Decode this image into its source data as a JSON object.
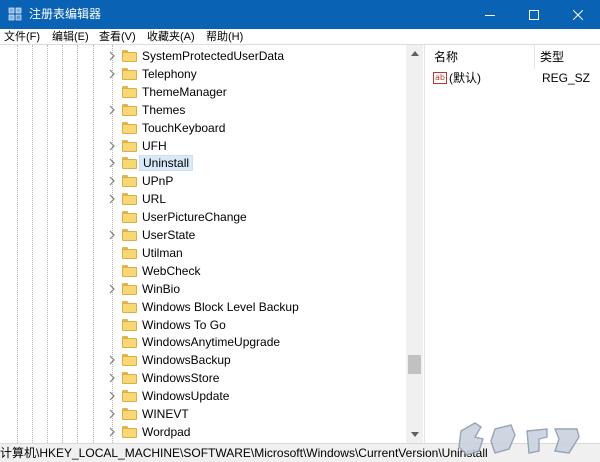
{
  "window": {
    "title": "注册表编辑器",
    "title_bar_color": "#0a62b5"
  },
  "menu": {
    "items": [
      "文件(F)",
      "编辑(E)",
      "查看(V)",
      "收藏夹(A)",
      "帮助(H)"
    ]
  },
  "tree": {
    "items": [
      {
        "label": "SystemProtectedUserData",
        "expandable": true,
        "selected": false
      },
      {
        "label": "Telephony",
        "expandable": true,
        "selected": false
      },
      {
        "label": "ThemeManager",
        "expandable": false,
        "selected": false
      },
      {
        "label": "Themes",
        "expandable": true,
        "selected": false
      },
      {
        "label": "TouchKeyboard",
        "expandable": false,
        "selected": false
      },
      {
        "label": "UFH",
        "expandable": true,
        "selected": false
      },
      {
        "label": "Uninstall",
        "expandable": true,
        "selected": true
      },
      {
        "label": "UPnP",
        "expandable": true,
        "selected": false
      },
      {
        "label": "URL",
        "expandable": true,
        "selected": false
      },
      {
        "label": "UserPictureChange",
        "expandable": false,
        "selected": false
      },
      {
        "label": "UserState",
        "expandable": true,
        "selected": false
      },
      {
        "label": "Utilman",
        "expandable": false,
        "selected": false
      },
      {
        "label": "WebCheck",
        "expandable": false,
        "selected": false
      },
      {
        "label": "WinBio",
        "expandable": true,
        "selected": false
      },
      {
        "label": "Windows Block Level Backup",
        "expandable": false,
        "selected": false
      },
      {
        "label": "Windows To Go",
        "expandable": false,
        "selected": false
      },
      {
        "label": "WindowsAnytimeUpgrade",
        "expandable": false,
        "selected": false
      },
      {
        "label": "WindowsBackup",
        "expandable": true,
        "selected": false
      },
      {
        "label": "WindowsStore",
        "expandable": true,
        "selected": false
      },
      {
        "label": "WindowsUpdate",
        "expandable": true,
        "selected": false
      },
      {
        "label": "WINEVT",
        "expandable": true,
        "selected": false
      },
      {
        "label": "Wordpad",
        "expandable": true,
        "selected": false
      }
    ]
  },
  "values": {
    "columns": {
      "name": "名称",
      "type": "类型"
    },
    "rows": [
      {
        "icon": "string-value-icon",
        "icon_text": "ab",
        "name": "(默认)",
        "type": "REG_SZ"
      }
    ]
  },
  "status": {
    "path": "计算机\\HKEY_LOCAL_MACHINE\\SOFTWARE\\Microsoft\\Windows\\CurrentVersion\\Uninstall"
  },
  "scroll": {
    "position_fraction": 0.85
  }
}
